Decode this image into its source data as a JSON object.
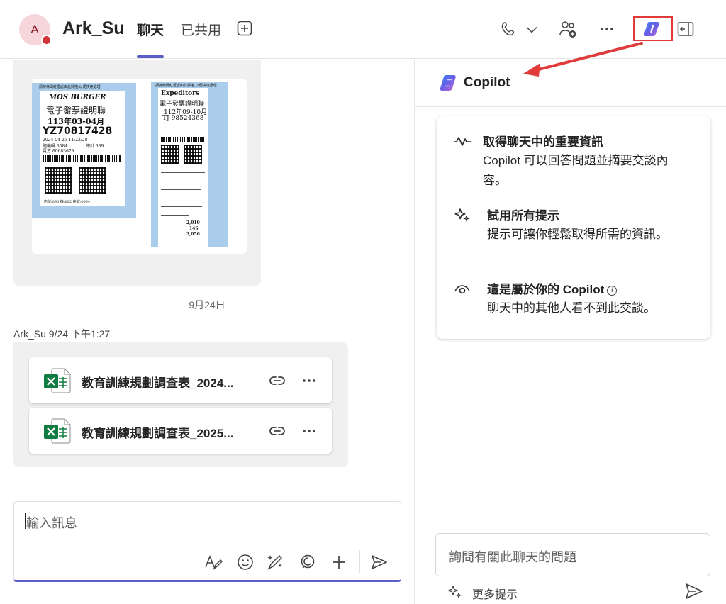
{
  "header": {
    "avatar_initial": "A",
    "chat_name": "Ark_Su",
    "tabs": [
      {
        "label": "聊天",
        "active": true
      },
      {
        "label": "已共用",
        "active": false
      }
    ],
    "icons": [
      "add-tab-icon",
      "call-icon",
      "chevron-down-icon",
      "add-people-icon",
      "more-icon",
      "copilot-icon",
      "open-panel-icon"
    ]
  },
  "chat": {
    "receipt_left": {
      "header_note": "請將條碼紅框處由此掃描,以便快速處理",
      "brand": "MOS BURGER",
      "doc_title": "電子發票證明聯",
      "period": "113年03-04月",
      "invoice_no": "YZ70817428",
      "datetime": "2024-04-26 11:22:28",
      "random_code": "隨機碼 3584",
      "total": "總計 389",
      "seller": "賣方 80683673",
      "footer": "店號:090 機:002 序號:0094"
    },
    "receipt_right": {
      "header_note": "請將條碼紅框處由此掃描,以便快速處理",
      "brand": "Expeditors",
      "doc_title": "電子發票證明聯",
      "period": "112年09-10月",
      "invoice_no": "TJ-98524368",
      "amounts": [
        "2,910",
        "146",
        "3,056"
      ]
    },
    "date_divider": "9月24日",
    "message_meta": "Ark_Su  9/24 下午1:27",
    "files": [
      {
        "name": "教育訓練規劃調查表_2024...",
        "icon": "excel-icon"
      },
      {
        "name": "教育訓練規劃調查表_2025...",
        "icon": "excel-icon"
      }
    ],
    "composer": {
      "placeholder": "輸入訊息",
      "tools": [
        "format-icon",
        "emoji-icon",
        "copilot-compose-icon",
        "loop-icon",
        "plus-icon",
        "send-icon"
      ]
    }
  },
  "copilot_pane": {
    "title": "Copilot",
    "features": [
      {
        "icon": "pulse-icon",
        "title": "取得聊天中的重要資訊",
        "desc": "Copilot 可以回答問題並摘要交談內容。"
      },
      {
        "icon": "sparkle-icon",
        "title": "試用所有提示",
        "desc": "提示可讓你輕鬆取得所需的資訊。"
      },
      {
        "icon": "eye-icon",
        "title": "這是屬於你的 Copilot",
        "desc": "聊天中的其他人看不到此交談。"
      }
    ],
    "ask_placeholder": "詢問有關此聊天的問題",
    "more_prompts": "更多提示"
  },
  "colors": {
    "accent": "#5b5fc7",
    "highlight_box": "#e03a3a",
    "arrow": "#e03a3a",
    "excel_green": "#107c41",
    "bubble_bg": "#f0f0f0",
    "avatar_bg": "#f6d6da",
    "presence_busy": "#d13438"
  }
}
